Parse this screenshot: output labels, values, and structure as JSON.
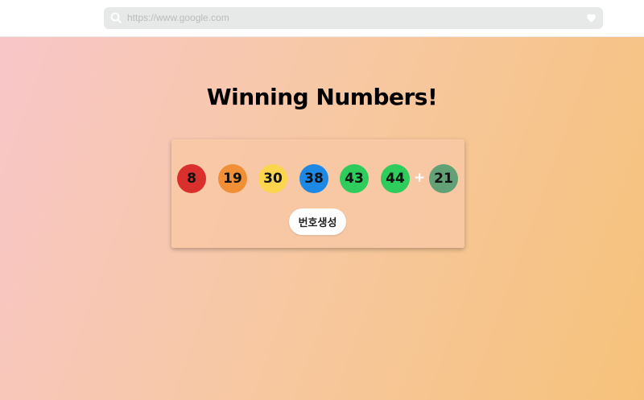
{
  "browser": {
    "url_placeholder": "https://www.google.com",
    "icons": {
      "search": "search-icon",
      "favorite": "heart-icon"
    }
  },
  "main": {
    "title": "Winning Numbers!",
    "plus_sign": "+",
    "generate_button_label": "번호생성",
    "balls": [
      {
        "number": "8",
        "color": "#d9302e"
      },
      {
        "number": "19",
        "color": "#f08f36"
      },
      {
        "number": "30",
        "color": "#fbd54d"
      },
      {
        "number": "38",
        "color": "#1e88e5"
      },
      {
        "number": "43",
        "color": "#2ecc5d"
      },
      {
        "number": "44",
        "color": "#2ecc5d"
      }
    ],
    "bonus_ball": {
      "number": "21",
      "color": "#62a076"
    }
  }
}
